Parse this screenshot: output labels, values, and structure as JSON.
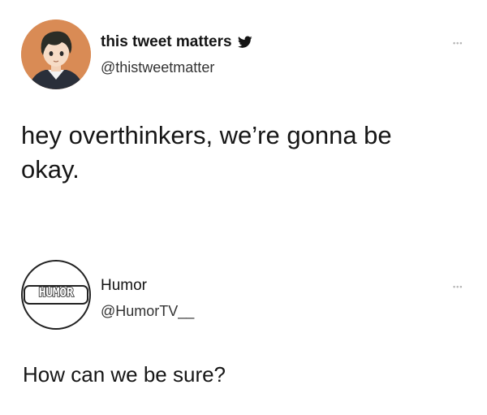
{
  "tweet1": {
    "display_name": "this tweet matters",
    "handle": "@thistweetmatter",
    "verified_icon": "twitter-bird-icon",
    "more_icon": "more-dots-icon",
    "more_label": "•••",
    "text": "hey overthinkers, we’re gonna be okay."
  },
  "tweet2": {
    "display_name": "Humor",
    "handle": "@HumorTV__",
    "avatar_text": "HUMOR",
    "more_icon": "more-dots-icon",
    "more_label": "•••",
    "text": "How can we be sure?"
  },
  "colors": {
    "avatar1_bg": "#d98b55",
    "humor_logo_fill": "#ffffff",
    "humor_logo_stroke": "#222222"
  }
}
